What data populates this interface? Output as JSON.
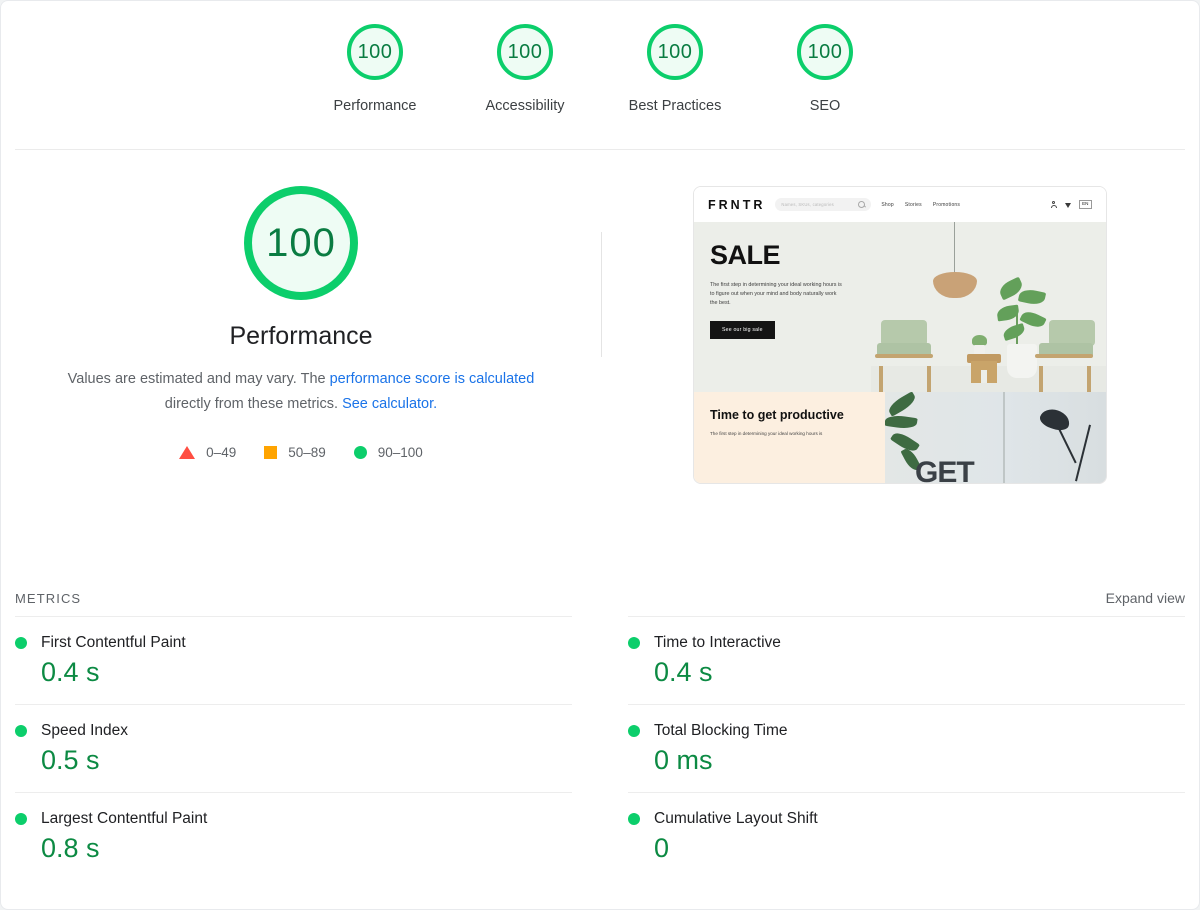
{
  "top_scores": [
    {
      "value": "100",
      "label": "Performance"
    },
    {
      "value": "100",
      "label": "Accessibility"
    },
    {
      "value": "100",
      "label": "Best Practices"
    },
    {
      "value": "100",
      "label": "SEO"
    }
  ],
  "hero": {
    "score": "100",
    "title": "Performance",
    "desc_part1": "Values are estimated and may vary. The ",
    "desc_link1": "performance score is calculated",
    "desc_part2": " directly from these metrics. ",
    "desc_link2": "See calculator.",
    "legend": [
      {
        "marker": "triangle-marker",
        "range": "0–49",
        "color": "#ff4e42"
      },
      {
        "marker": "square-marker",
        "range": "50–89",
        "color": "#ffa400"
      },
      {
        "marker": "circle-marker",
        "range": "90–100",
        "color": "#0cce6b"
      }
    ]
  },
  "thumbnail": {
    "brand": "FRNTR",
    "search_placeholder": "Names, SKUs, categories",
    "nav": [
      "Shop",
      "Stories",
      "Promotions"
    ],
    "lang": "EN",
    "hero_title": "SALE",
    "hero_text": "The first step in determining your ideal working hours is to figure out when your mind and body naturally work the best.",
    "hero_button": "See our big sale",
    "banner_title": "Time to get productive",
    "banner_text": "The first step in determining your ideal working hours is",
    "banner_image_word": "GET"
  },
  "metrics_section": {
    "title": "METRICS",
    "expand_label": "Expand view",
    "left": [
      {
        "name": "First Contentful Paint",
        "value": "0.4 s",
        "status": "pass"
      },
      {
        "name": "Speed Index",
        "value": "0.5 s",
        "status": "pass"
      },
      {
        "name": "Largest Contentful Paint",
        "value": "0.8 s",
        "status": "pass"
      }
    ],
    "right": [
      {
        "name": "Time to Interactive",
        "value": "0.4 s",
        "status": "pass"
      },
      {
        "name": "Total Blocking Time",
        "value": "0 ms",
        "status": "pass"
      },
      {
        "name": "Cumulative Layout Shift",
        "value": "0",
        "status": "pass"
      }
    ]
  },
  "colors": {
    "pass": "#0cce6b",
    "pass_text": "#0c8a43",
    "average": "#ffa400",
    "fail": "#ff4e42",
    "link": "#1a73e8"
  }
}
